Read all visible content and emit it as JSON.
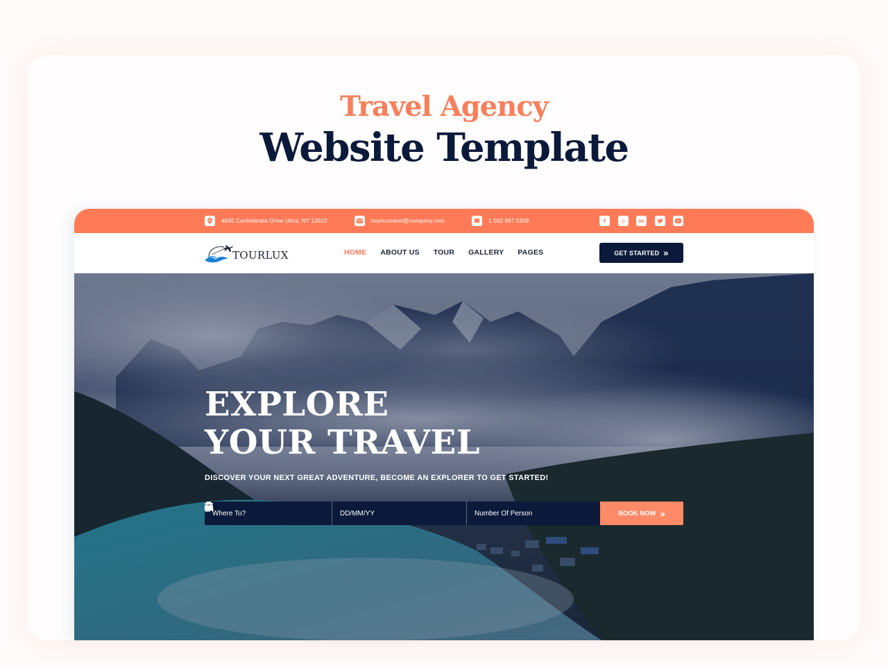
{
  "colors": {
    "accent": "#ff7b57",
    "navy": "#0b1a3a",
    "page_bg": "#fefbfa"
  },
  "headline": {
    "subtitle": "Travel Agency",
    "title": "Website Template"
  },
  "topbar": {
    "address": {
      "icon": "map-pin-icon",
      "text": "4845 Confederate Drive Utica, NY 13502"
    },
    "email": {
      "icon": "envelope-icon",
      "text": "tourluxtravel@company.com"
    },
    "phone": {
      "icon": "phone-icon",
      "text": "1 562 867 5309"
    },
    "social": [
      {
        "name": "facebook-icon",
        "glyph": "f"
      },
      {
        "name": "instagram-icon",
        "glyph": "◎"
      },
      {
        "name": "linkedin-icon",
        "glyph": "in"
      },
      {
        "name": "twitter-icon",
        "glyph": "🐦"
      },
      {
        "name": "youtube-icon",
        "glyph": "▶"
      }
    ]
  },
  "navbar": {
    "logo_text": "TOURLUX",
    "items": [
      {
        "label": "HOME",
        "active": true
      },
      {
        "label": "ABOUT US"
      },
      {
        "label": "TOUR"
      },
      {
        "label": "GALLERY"
      },
      {
        "label": "PAGES"
      }
    ],
    "cta_label": "GET STARTED",
    "cta_icon": "»"
  },
  "hero": {
    "title_line1": "EXPLORE",
    "title_line2": "YOUR TRAVEL",
    "subtitle": "DISCOVER YOUR NEXT GREAT ADVENTURE, BECOME AN EXPLORER TO GET STARTED!",
    "search": {
      "destination_placeholder": "Where To?",
      "date_placeholder": "DD/MM/YY",
      "persons_placeholder": "Number Of Person",
      "book_label": "BOOK NOW",
      "book_icon": "»"
    }
  }
}
